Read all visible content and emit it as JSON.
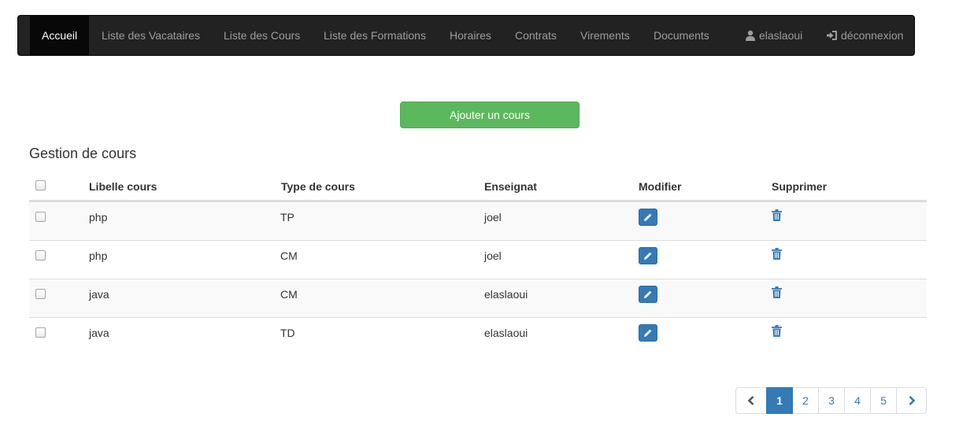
{
  "navbar": {
    "items": [
      {
        "label": "Accueil"
      },
      {
        "label": "Liste des Vacataires"
      },
      {
        "label": "Liste des Cours"
      },
      {
        "label": "Liste des Formations"
      },
      {
        "label": "Horaires"
      },
      {
        "label": "Contrats"
      },
      {
        "label": "Virements"
      },
      {
        "label": "Documents"
      }
    ],
    "user": {
      "label": "elaslaoui",
      "icon": "user-icon"
    },
    "logout": {
      "label": "déconnexion",
      "icon": "log-in-icon"
    }
  },
  "actions": {
    "add_label": "Ajouter un cours"
  },
  "section": {
    "title": "Gestion de cours"
  },
  "table": {
    "headers": [
      "Libelle cours",
      "Type de cours",
      "Enseignat",
      "Modifier",
      "Supprimer"
    ],
    "rows": [
      {
        "libelle": "php",
        "type": "TP",
        "enseignant": "joel"
      },
      {
        "libelle": "php",
        "type": "CM",
        "enseignant": "joel"
      },
      {
        "libelle": "java",
        "type": "CM",
        "enseignant": "elaslaoui"
      },
      {
        "libelle": "java",
        "type": "TD",
        "enseignant": "elaslaoui"
      }
    ]
  },
  "pagination": {
    "pages": [
      "1",
      "2",
      "3",
      "4",
      "5"
    ],
    "current": "1",
    "prev_icon": "chevron-left-icon",
    "next_icon": "chevron-right-icon"
  },
  "colors": {
    "navbar_bg": "#222222",
    "add_button": "#5cb85c",
    "edit_button": "#337ab7",
    "link": "#337ab7"
  }
}
